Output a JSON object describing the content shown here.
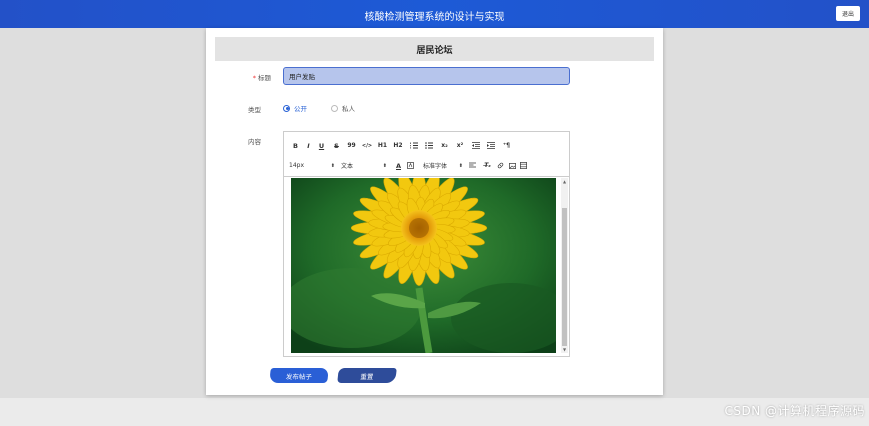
{
  "header": {
    "title": "核酸检测管理系统的设计与实现",
    "logout_label": "退出"
  },
  "card": {
    "title": "居民论坛"
  },
  "form": {
    "title_label": "标题",
    "title_required_mark": "*",
    "title_value": "用户发贴",
    "type_label": "类型",
    "type_options": [
      {
        "label": "公开",
        "selected": true
      },
      {
        "label": "私人",
        "selected": false
      }
    ],
    "content_label": "内容"
  },
  "editor": {
    "toolbar_row1": [
      "B",
      "I",
      "U",
      "S",
      "99",
      "</>",
      "H1",
      "H2",
      "ol",
      "ul",
      "x₂",
      "x²",
      "outdent",
      "indent",
      "pilcrow"
    ],
    "font_size": "14px",
    "header_select": "文本",
    "font_family": "标准字体",
    "image_alt": "yellow-flower-photo"
  },
  "actions": {
    "publish_label": "发布帖子",
    "reset_label": "重置"
  },
  "watermark": "CSDN @计算机程序源码",
  "colors": {
    "header_blue": "#2351c8",
    "accent_blue": "#2a63d6",
    "input_bg": "#b6c5ec"
  }
}
